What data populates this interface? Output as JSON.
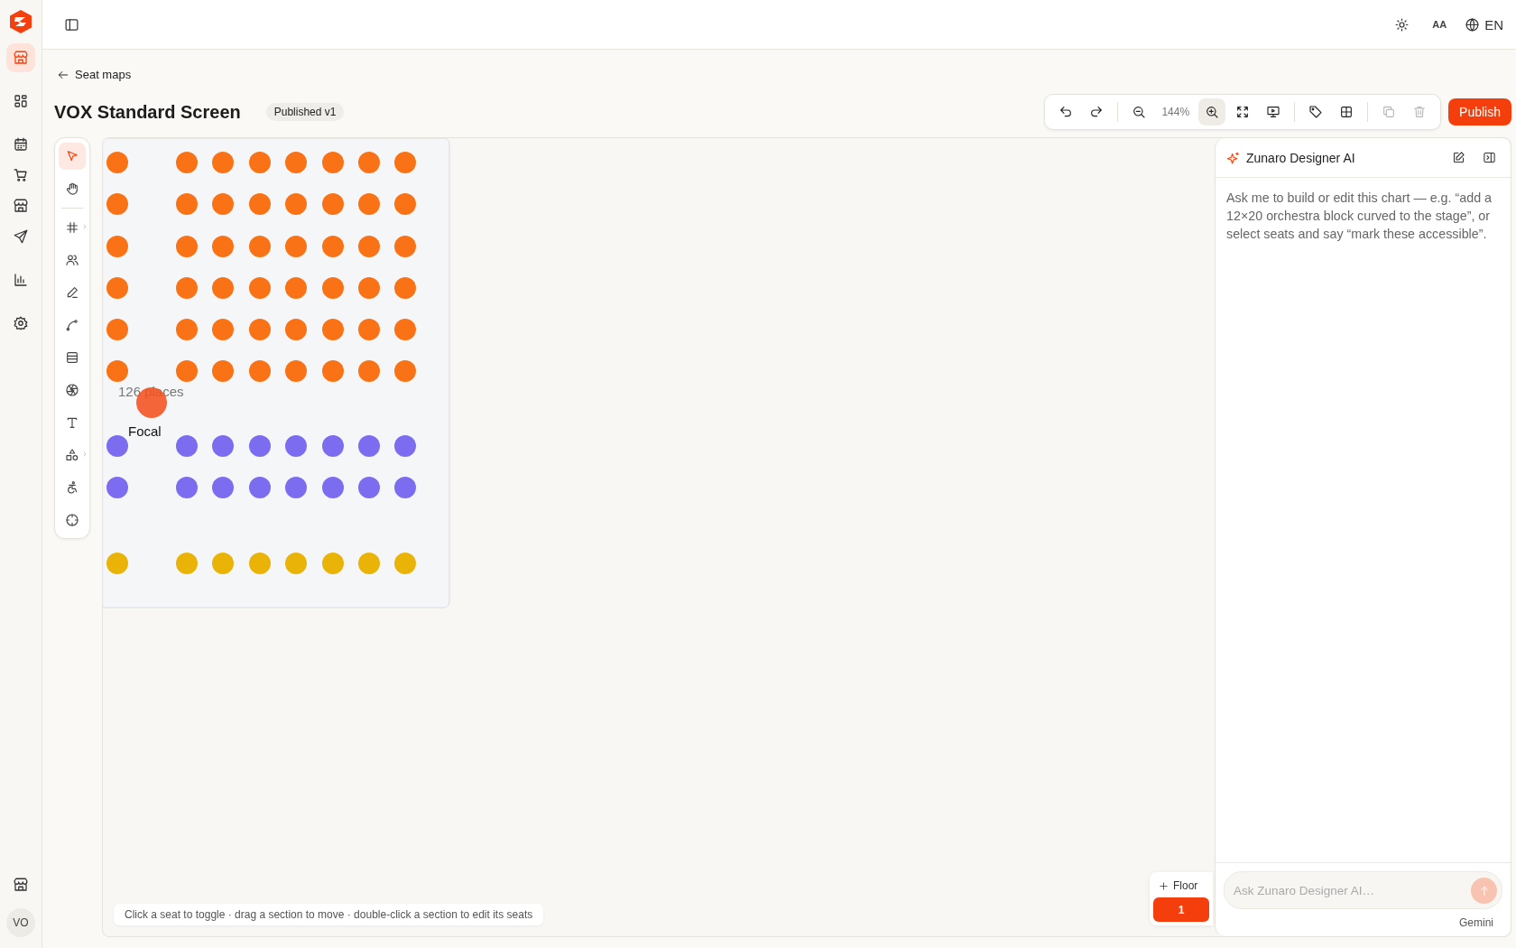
{
  "sidebar": {
    "items": [
      {
        "selected": true
      },
      {
        "selected": false
      },
      {
        "selected": false
      },
      {
        "selected": false
      },
      {
        "selected": false
      },
      {
        "selected": false
      },
      {
        "selected": false
      },
      {
        "selected": false
      }
    ],
    "footer_items": [
      {
        "selected": false
      }
    ],
    "avatar": "VO"
  },
  "top_bar": {
    "text_size_label": "AA",
    "language": "EN"
  },
  "breadcrumb": "Seat maps",
  "title": "VOX Standard Screen",
  "status_badge": "Published v1",
  "toolbar": {
    "zoom_level": "144%",
    "buttons": [
      {
        "selected": false,
        "disabled": false
      },
      {
        "selected": false,
        "disabled": false
      },
      {
        "selected": false,
        "disabled": false
      },
      {
        "selected": true,
        "disabled": false
      },
      {
        "selected": false,
        "disabled": false
      },
      {
        "selected": false,
        "disabled": false
      },
      {
        "selected": false,
        "disabled": false
      },
      {
        "selected": false,
        "disabled": false
      },
      {
        "selected": false,
        "disabled": true
      },
      {
        "selected": false,
        "disabled": true
      }
    ],
    "publish": "Publish"
  },
  "tool_palette": [
    {
      "selected": true
    },
    {
      "selected": false
    },
    {
      "selected": false
    },
    {
      "selected": false
    },
    {
      "selected": false
    },
    {
      "selected": false
    },
    {
      "selected": false
    },
    {
      "selected": false
    },
    {
      "selected": false
    },
    {
      "selected": false
    },
    {
      "selected": false
    },
    {
      "selected": false
    }
  ],
  "canvas": {
    "seat_rows": [
      {
        "color": "#f97316"
      },
      {
        "color": "#f97316"
      },
      {
        "color": "#f97316"
      },
      {
        "color": "#f97316"
      },
      {
        "color": "#f97316"
      },
      {
        "color": "#f97316"
      },
      {
        "color": "#7b6cf0"
      },
      {
        "color": "#7b6cf0"
      },
      {
        "color": "#eab308"
      }
    ],
    "section_label": "126 places",
    "focal_label": "Focal",
    "hint": "Click a seat to toggle · drag a section to move · double-click a section to edit its seats"
  },
  "floors": {
    "add_label": "Floor",
    "items": [
      {
        "label": "1",
        "selected": true
      }
    ]
  },
  "ai_panel": {
    "title": "Zunaro Designer AI",
    "intro": "Ask me to build or edit this chart — e.g. “add a 12×20 orchestra block curved to the stage”, or select seats and say “mark these accessible”.",
    "placeholder": "Ask Zunaro Designer AI…",
    "model": "Gemini"
  }
}
